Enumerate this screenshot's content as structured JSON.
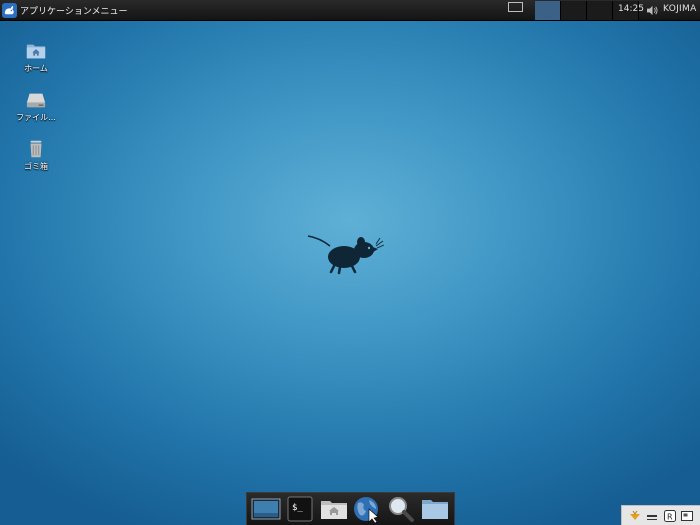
{
  "top_panel": {
    "app_menu_label": "アプリケーションメニュー",
    "workspaces": [
      {
        "name": "workspace-1",
        "active": true
      },
      {
        "name": "workspace-2",
        "active": false
      },
      {
        "name": "workspace-3",
        "active": false
      },
      {
        "name": "workspace-4",
        "active": false
      }
    ],
    "clock": "14:25",
    "user": "KOJIMA"
  },
  "desktop_icons": [
    {
      "label": "ホーム",
      "icon": "home-folder-icon"
    },
    {
      "label": "ファイル...",
      "icon": "filesystem-drive-icon"
    },
    {
      "label": "ゴミ箱",
      "icon": "trash-icon"
    }
  ],
  "dock": [
    {
      "icon": "show-desktop-icon"
    },
    {
      "icon": "terminal-icon"
    },
    {
      "icon": "home-folder-icon"
    },
    {
      "icon": "web-browser-icon"
    },
    {
      "icon": "app-finder-icon"
    },
    {
      "icon": "file-manager-icon"
    }
  ],
  "tray": [
    {
      "icon": "updates-icon"
    },
    {
      "icon": "input-method-icon"
    },
    {
      "icon": "r-icon",
      "text": "R"
    },
    {
      "icon": "display-icon"
    }
  ],
  "colors": {
    "panel": "#1e1e1e",
    "active_workspace": "#3c6187",
    "wallpaper_center": "#5fb0d6",
    "wallpaper_edge": "#155d92"
  }
}
